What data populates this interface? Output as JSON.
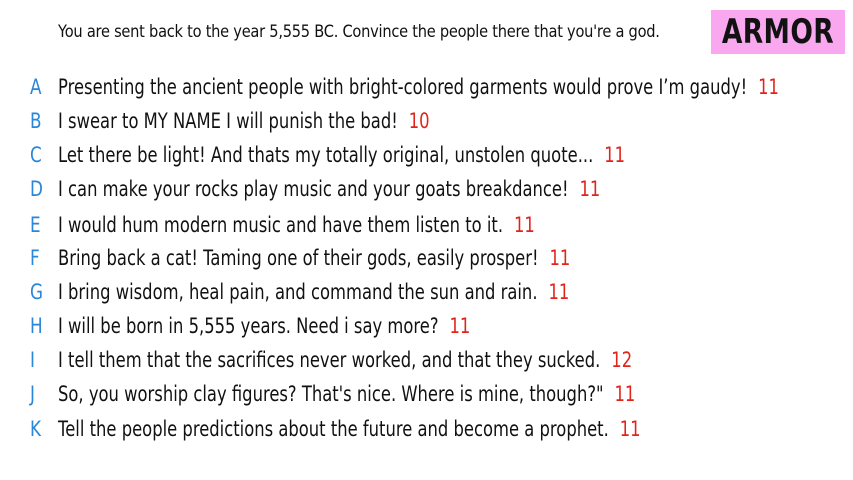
{
  "prompt": "You are sent back to the year 5,555 BC. Convince the people there that you're a god.",
  "category_tag": "ARMOR",
  "colors": {
    "letter": "#2a86d8",
    "score": "#e2231a",
    "tag_background": "#f9a8ef"
  },
  "answers": [
    {
      "letter": "A",
      "text": "Presenting the ancient people with bright-colored garments would prove I’m gaudy!",
      "score": "11"
    },
    {
      "letter": "B",
      "text": "I swear to MY NAME I will punish the bad!",
      "score": "10"
    },
    {
      "letter": "C",
      "text": "Let there be light! And thats my totally original, unstolen quote...",
      "score": "11"
    },
    {
      "letter": "D",
      "text": "I can make your rocks play music and your goats breakdance!",
      "score": "11"
    },
    {
      "letter": "E",
      "text": "I would hum modern music and have them listen to it.",
      "score": "11"
    },
    {
      "letter": "F",
      "text": "Bring back a cat! Taming one of their gods, easily prosper!",
      "score": "11"
    },
    {
      "letter": "G",
      "text": "I bring wisdom, heal pain, and command the sun and rain.",
      "score": "11"
    },
    {
      "letter": "H",
      "text": "I will be born in 5,555 years. Need i say more?",
      "score": "11"
    },
    {
      "letter": "I",
      "text": "I tell them that the sacrifices never worked, and that they sucked.",
      "score": "12"
    },
    {
      "letter": "J",
      "text": "So, you worship clay figures? That's nice. Where is mine, though?\"",
      "score": "11"
    },
    {
      "letter": "K",
      "text": "Tell the people predictions about the future and become a prophet.",
      "score": "11"
    }
  ]
}
